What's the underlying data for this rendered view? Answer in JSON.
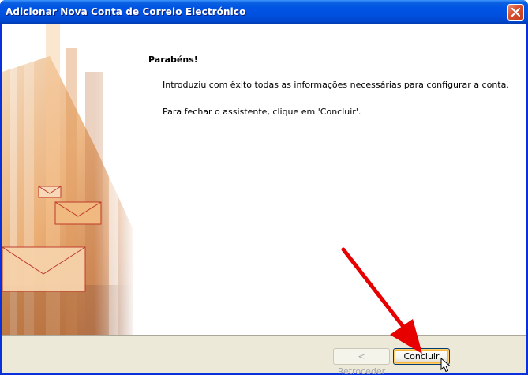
{
  "window": {
    "title": "Adicionar Nova Conta de Correio Electrónico"
  },
  "content": {
    "heading": "Parabéns!",
    "paragraph1": "Introduziu com êxito todas as informações necessárias para configurar a conta.",
    "paragraph2": "Para fechar o assistente, clique em 'Concluir'."
  },
  "buttons": {
    "back_label": "< Retroceder",
    "finish_label": "Concluir"
  },
  "colors": {
    "titlebar": "#0055e5",
    "annotation_arrow": "#e60000",
    "dialog_bg": "#ece9d8"
  },
  "icons": {
    "close": "close-icon",
    "cursor": "mouse-pointer-icon",
    "annotation": "red-arrow-annotation"
  }
}
